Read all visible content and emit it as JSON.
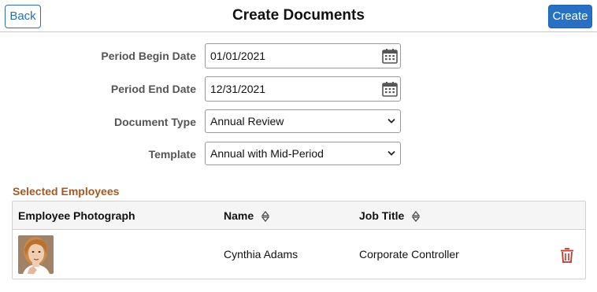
{
  "header": {
    "back_label": "Back",
    "title": "Create Documents",
    "create_label": "Create"
  },
  "form": {
    "begin_date": {
      "label": "Period Begin Date",
      "value": "01/01/2021",
      "icon": "calendar-icon"
    },
    "end_date": {
      "label": "Period End Date",
      "value": "12/31/2021",
      "icon": "calendar-icon"
    },
    "document_type": {
      "label": "Document Type",
      "value": "Annual Review",
      "icon": "chevron-down-icon"
    },
    "template": {
      "label": "Template",
      "value": "Annual with Mid-Period",
      "icon": "chevron-down-icon"
    }
  },
  "selected_employees": {
    "title": "Selected Employees",
    "columns": [
      {
        "label": "Employee Photograph",
        "sortable": false
      },
      {
        "label": "Name",
        "sortable": true
      },
      {
        "label": "Job Title",
        "sortable": true
      }
    ],
    "rows": [
      {
        "name": "Cynthia Adams",
        "job_title": "Corporate Controller",
        "photo": "employee-photo",
        "action_icon": "trash-icon"
      }
    ]
  },
  "colors": {
    "accent": "#2670c6",
    "section_title": "#a8581e",
    "delete_icon": "#c0392b"
  }
}
